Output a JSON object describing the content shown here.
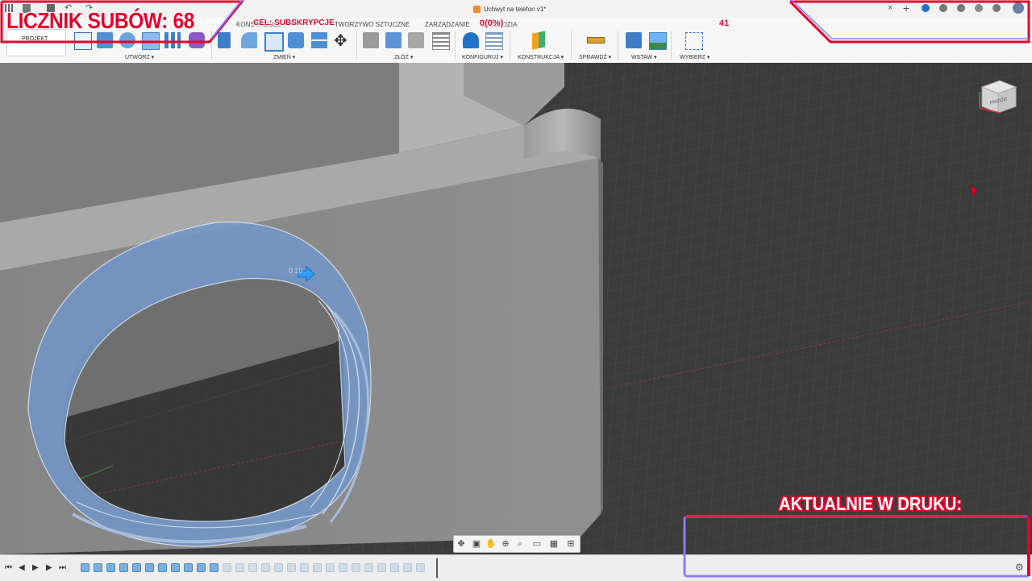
{
  "window": {
    "title": "Uchwyt na telefon v1*"
  },
  "tabs": [
    "KONSTRUKCJA",
    "TWORZYWO SZTUCZNE",
    "ZARZĄDZANIE",
    "NARZĘDZIA"
  ],
  "workspace": {
    "label": "PROJEKT"
  },
  "toolbar_groups": [
    {
      "label": "UTWÓRZ ▾"
    },
    {
      "label": "ZMIEŃ ▾"
    },
    {
      "label": "ZŁÓŻ ▾"
    },
    {
      "label": "KONFIGURUJ ▾"
    },
    {
      "label": "KONSTRUKCJA ▾"
    },
    {
      "label": "SPRAWDŹ ▾"
    },
    {
      "label": "WSTAW ▾"
    },
    {
      "label": "WYBIERZ ▾"
    }
  ],
  "overlay": {
    "sub_counter": "LICZNIK SUBÓW: 68",
    "goal_label": "CEL: SUBSKRYPCJE",
    "goal_progress": "0(0%)",
    "goal_target": "41",
    "printing_label": "AKTUALNIE W DRUKU:"
  },
  "viewport": {
    "dimension_label": "0.10",
    "viewcube_label": "PRZÓD"
  },
  "colors": {
    "accent_pink": "#e4002b",
    "accent_purple": "#8a7cff",
    "selection_blue": "#6f92c9",
    "body_gray": "#8f8f8f"
  },
  "icons": {
    "timeline_controls": [
      "skip-back-icon",
      "step-back-icon",
      "play-icon",
      "step-forward-icon",
      "skip-forward-icon"
    ],
    "navbar": [
      "orbit-icon",
      "look-at-icon",
      "pan-icon",
      "zoom-icon",
      "fit-icon",
      "display-icon",
      "grid-icon",
      "viewports-icon"
    ]
  }
}
